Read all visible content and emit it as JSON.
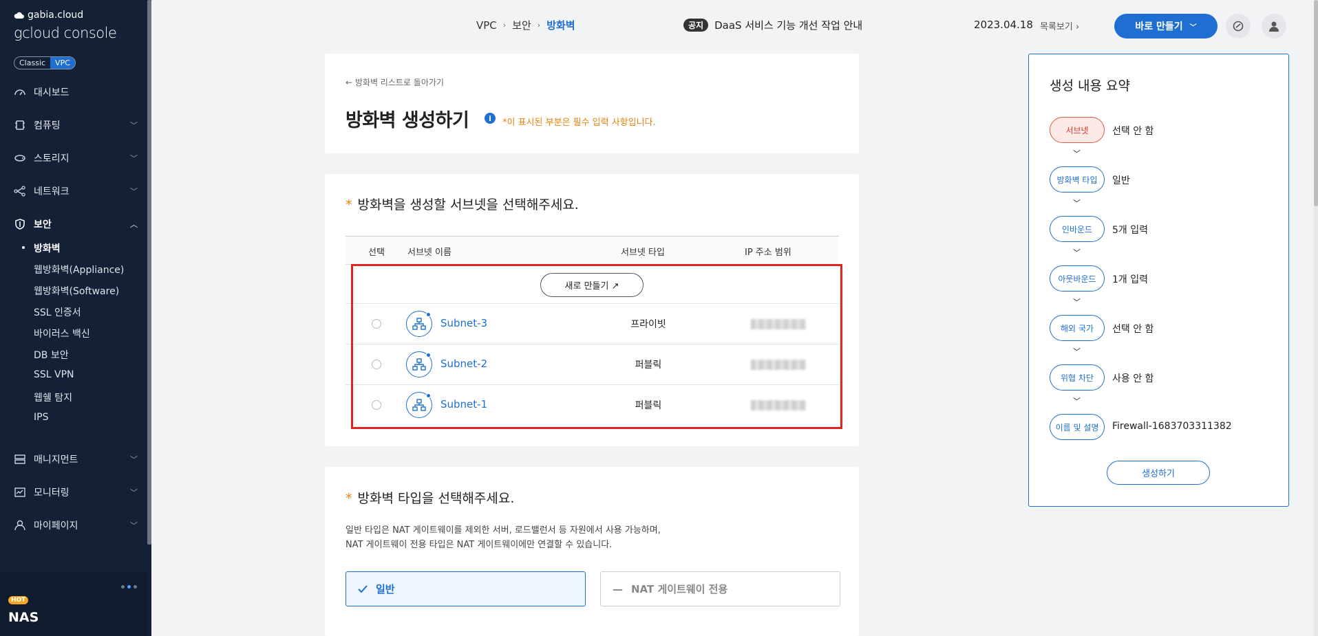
{
  "sidebar": {
    "brand_small": "gabia.cloud",
    "brand_big": "gcloud console",
    "toggle": {
      "classic": "Classic",
      "vpc": "VPC"
    },
    "menu": [
      {
        "label": "대시보드",
        "icon": "dashboard-icon"
      },
      {
        "label": "컴퓨팅",
        "icon": "computing-icon"
      },
      {
        "label": "스토리지",
        "icon": "storage-icon"
      },
      {
        "label": "네트워크",
        "icon": "network-icon"
      },
      {
        "label": "보안",
        "icon": "shield-icon"
      },
      {
        "label": "매니지먼트",
        "icon": "management-icon"
      },
      {
        "label": "모니터링",
        "icon": "monitoring-icon"
      },
      {
        "label": "마이페이지",
        "icon": "user-icon"
      }
    ],
    "security_sub": [
      "방화벽",
      "웹방화벽(Appliance)",
      "웹방화벽(Software)",
      "SSL 인증서",
      "바이러스 백신",
      "DB 보안",
      "SSL VPN",
      "웹쉘 탐지",
      "IPS"
    ],
    "promo": {
      "badge": "HOT",
      "title": "NAS"
    }
  },
  "header": {
    "breadcrumb": [
      "VPC",
      "보안",
      "방화벽"
    ],
    "notice_tag": "공지",
    "notice_text": "DaaS 서비스 기능 개선 작업 안내",
    "date": "2023.04.18",
    "list_link": "목록보기",
    "make_button": "바로 만들기"
  },
  "page": {
    "back_link": "방화벽 리스트로 돌아가기",
    "title": "방화벽 생성하기",
    "required_note": "*이 표시된 부분은 필수 입력 사항입니다."
  },
  "subnet_section": {
    "title": "방화벽을 생성할 서브넷을 선택해주세요.",
    "columns": [
      "선택",
      "서브넷 이름",
      "서브넷 타입",
      "IP 주소 범위"
    ],
    "new_button": "새로 만들기 ↗",
    "rows": [
      {
        "name": "Subnet-3",
        "type": "프라이빗"
      },
      {
        "name": "Subnet-2",
        "type": "퍼블릭"
      },
      {
        "name": "Subnet-1",
        "type": "퍼블릭"
      }
    ]
  },
  "type_section": {
    "title": "방화벽 타입을 선택해주세요.",
    "desc_line1": "일반 타입은 NAT 게이트웨이를 제외한 서버, 로드밸런서 등 자원에서 사용 가능하며,",
    "desc_line2": "NAT 게이트웨이 전용 타입은 NAT 게이트웨이에만 연결할 수 있습니다.",
    "options": [
      "일반",
      "NAT 게이트웨이 전용"
    ]
  },
  "summary": {
    "title": "생성 내용 요약",
    "steps": [
      {
        "label": "서브넷",
        "value": "선택 안 함"
      },
      {
        "label": "방화벽 타입",
        "value": "일반"
      },
      {
        "label": "인바운드",
        "value": "5개 입력"
      },
      {
        "label": "아웃바운드",
        "value": "1개 입력"
      },
      {
        "label": "해외 국가",
        "value": "선택 안 함"
      },
      {
        "label": "위협 차단",
        "value": "사용 안 함"
      },
      {
        "label": "이름 및 설명",
        "value": "Firewall-1683703311382"
      }
    ],
    "create_button": "생성하기"
  },
  "colors": {
    "accent": "#1e6fd1",
    "sidebar": "#132035",
    "required": "#e8830c",
    "highlight": "#e02424"
  }
}
